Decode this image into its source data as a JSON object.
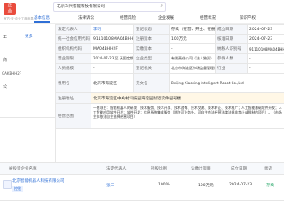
{
  "header": {
    "logo_lines": [
      "企",
      "业"
    ],
    "sub_label": "官方·查·企业工商信息",
    "tabs": [
      "基本信息",
      "法律诉讼",
      "经营风险",
      "企业发展",
      "经营状况",
      "知识产权"
    ],
    "search_value": "北京华兴智能科技有限公司",
    "search_button_label": "查"
  },
  "sidebar": {
    "items": [
      "工",
      "商",
      "公"
    ],
    "code_text": "GAKBHH2F",
    "more_text": "更多"
  },
  "info_table": {
    "rows": [
      {
        "label1": "法定代表人",
        "value1": "李明",
        "label2": "登记状态",
        "value2": "存续（在营、开业、在册）",
        "label3": "成立日期",
        "value3": "2024-07-23"
      },
      {
        "label1": "统一社会信用代码",
        "value1": "91110108MA04BHH2F",
        "label2": "注册资本",
        "value2": "100万元",
        "label3": "核准日期",
        "value3": "2024-07-23"
      },
      {
        "label1": "组织机构代码",
        "value1": "MA04BHH2F",
        "label2": "实缴资本",
        "value2": "-",
        "label3": "纳税人识别号",
        "value3": "91110108MA04BHH2F"
      },
      {
        "label1": "营业期限",
        "value1": "2024-07-23 至 无固定期限",
        "label2": "企业类型",
        "value2": "有限责任公司（法人独资）",
        "label3": "参保人数",
        "value3": "-"
      },
      {
        "label1": "人员规模",
        "value1": "-",
        "label2": "登记机关",
        "value2": "北京市海淀区市场监督管理局",
        "label3": "行业",
        "value3": "-"
      },
      {
        "label1": "曾用名",
        "value1": "北京市海淀区",
        "label2": "英文名",
        "value2": "Beijing Xiaoxing Intelligent Robot Co.,Ltd",
        "label3": "",
        "value3": ""
      }
    ],
    "address_label": "注册地址",
    "address_value": "北京市海淀区中关村科技园海淀园附近软件园号楼",
    "scope_label": "经营范围",
    "scope_value": "一般项目：智能机器人的研发；技术服务、技术开发、技术咨询、技术交流、技术转让、技术推广；人工智能基础软件开发；人工智能应用软件开发；软件开发；信息系统集成服务（除许可业务外，可自主依法经营法律法规非禁止或限制的项目）。（市场主体依法自主选择经营项目）"
  },
  "investment": {
    "headers": [
      "被投资企业名称",
      "法定代表人",
      "持股比例",
      "认缴出资额",
      "成立日期",
      "状态"
    ],
    "row": {
      "name": "北京智能机器人科技有限公司",
      "tag": "控股",
      "person": "张三",
      "ratio": "100%",
      "amount": "100万元",
      "date": "2024-07-23",
      "status": "存续"
    }
  }
}
